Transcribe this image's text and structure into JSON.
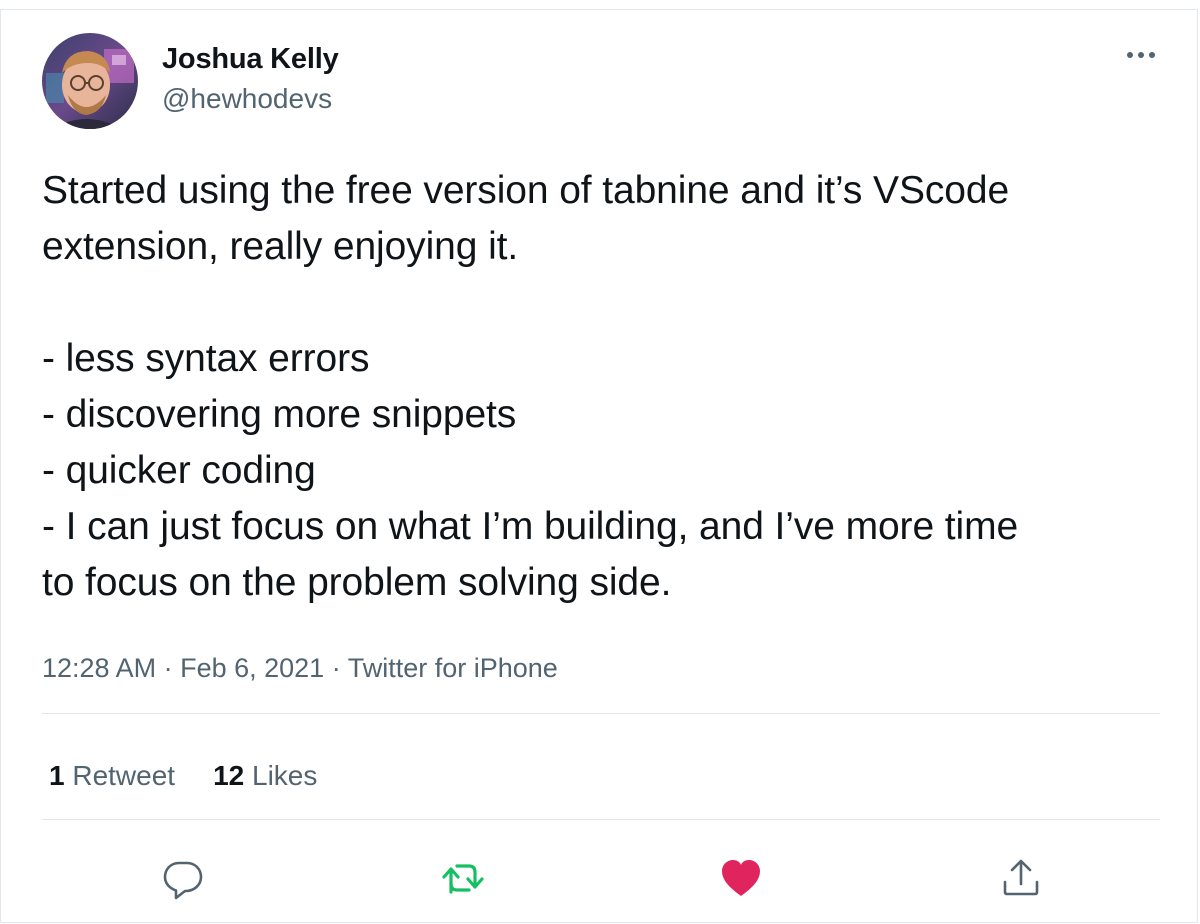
{
  "author": {
    "display_name": "Joshua Kelly",
    "handle": "@hewhodevs"
  },
  "tweet": {
    "lines_paragraph1": [
      "Started using the free version of tabnine and it’s VScode",
      "extension, really enjoying it."
    ],
    "lines_paragraph2": [
      "- less syntax errors",
      "- discovering more snippets",
      "- quicker coding",
      "- I can just focus on what I’m building, and I’ve more time",
      "to focus on the problem solving side."
    ]
  },
  "meta": {
    "time": "12:28 AM",
    "separator": " · ",
    "date": "Feb 6, 2021",
    "source": "Twitter for iPhone"
  },
  "stats": {
    "retweets_count": "1",
    "retweets_label": "Retweet",
    "likes_count": "12",
    "likes_label": "Likes"
  },
  "icons": {
    "more": "more-dots-icon",
    "reply": "reply-icon",
    "retweet": "retweet-icon",
    "like": "heart-icon",
    "share": "share-icon"
  },
  "colors": {
    "text_primary": "#0f1419",
    "text_secondary": "#536471",
    "retweet_green": "#17bf63",
    "like_red": "#e0245e",
    "divider": "#e1e8ed"
  }
}
